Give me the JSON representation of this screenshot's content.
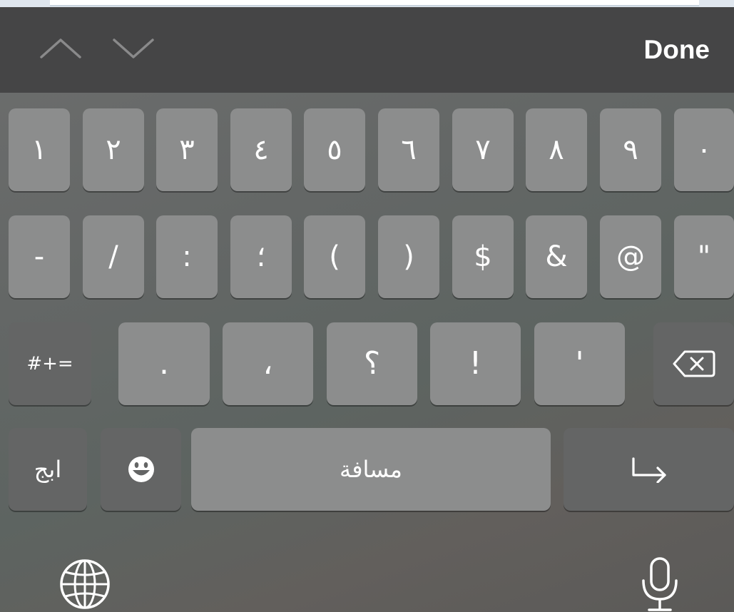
{
  "toolbar": {
    "prev_icon": "chevron-up-icon",
    "next_icon": "chevron-down-icon",
    "done_label": "Done"
  },
  "keyboard": {
    "row1": [
      "١",
      "٢",
      "٣",
      "٤",
      "٥",
      "٦",
      "٧",
      "٨",
      "٩",
      "٠"
    ],
    "row2": [
      "-",
      "/",
      ":",
      "؛",
      "(",
      ")",
      "$",
      "&",
      "@",
      "\""
    ],
    "row3": {
      "symbols_key": "#+=",
      "keys": [
        ".",
        "،",
        "؟",
        "!",
        "'"
      ],
      "delete_icon": "backspace-icon"
    },
    "row4": {
      "letters_key": "ابج",
      "emoji_icon": "emoji-icon",
      "space_label": "مسافة",
      "return_icon": "return-icon"
    },
    "bottom": {
      "globe_icon": "globe-icon",
      "mic_icon": "microphone-icon"
    }
  },
  "colors": {
    "toolbar_bg": "#454546",
    "key_light": "#8c8d8d",
    "key_dark": "#646565",
    "text": "#ffffff"
  }
}
